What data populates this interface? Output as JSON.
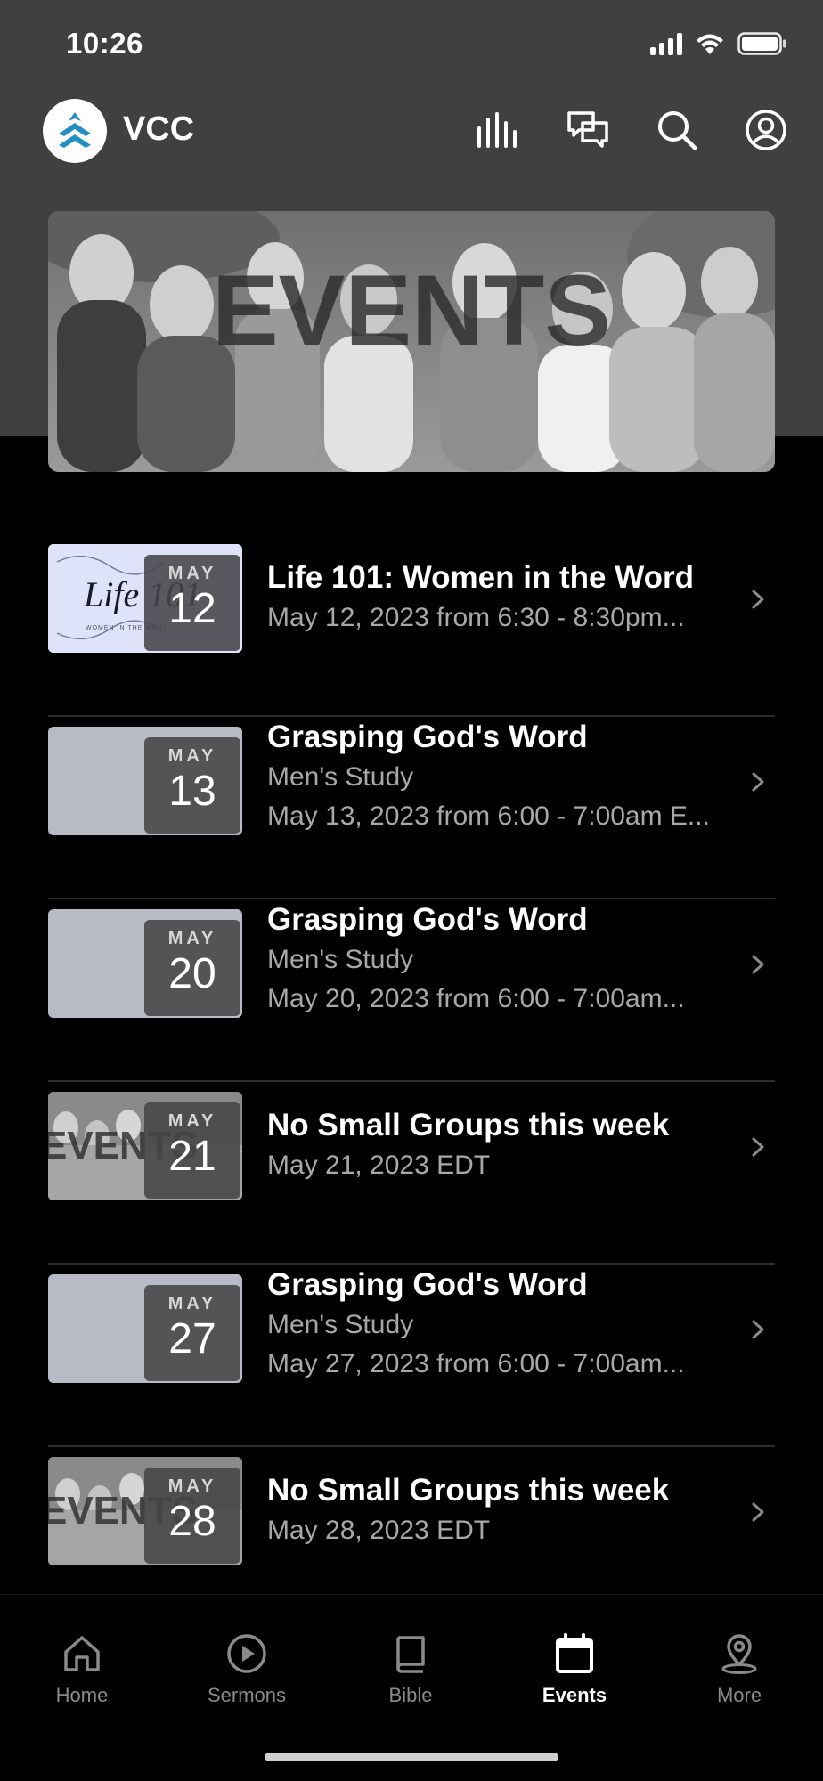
{
  "status_bar": {
    "time": "10:26",
    "icons": [
      "cellular-signal-icon",
      "wifi-icon",
      "battery-icon"
    ]
  },
  "header": {
    "app_title": "VCC",
    "icons": [
      "audio-bars-icon",
      "chat-icon",
      "search-icon",
      "profile-icon"
    ]
  },
  "banner": {
    "text": "EVENTS"
  },
  "events": [
    {
      "title": "Life 101: Women in the Word",
      "subtitle": "",
      "datetime": "May 12, 2023 from 6:30 - 8:30pm...",
      "month": "MAY",
      "day": "12",
      "thumb_logo": "Life 101",
      "thumb_caption": "WOMEN IN THE WORD"
    },
    {
      "title": "Grasping God's Word",
      "subtitle": "Men's Study",
      "datetime": "May 13, 2023 from 6:00 - 7:00am E...",
      "month": "MAY",
      "day": "13"
    },
    {
      "title": "Grasping God's Word",
      "subtitle": "Men's Study",
      "datetime": "May 20, 2023 from 6:00 - 7:00am...",
      "month": "MAY",
      "day": "20"
    },
    {
      "title": "No Small Groups this week",
      "subtitle": "",
      "datetime": "May 21, 2023 EDT",
      "month": "MAY",
      "day": "21",
      "thumb_text": "EVENTS"
    },
    {
      "title": "Grasping God's Word",
      "subtitle": "Men's Study",
      "datetime": "May 27, 2023 from 6:00 - 7:00am...",
      "month": "MAY",
      "day": "27"
    },
    {
      "title": "No Small Groups this week",
      "subtitle": "",
      "datetime": "May 28, 2023 EDT",
      "month": "MAY",
      "day": "28",
      "thumb_text": "EVENTS"
    }
  ],
  "tab_bar": {
    "tabs": [
      {
        "label": "Home",
        "icon": "home-icon"
      },
      {
        "label": "Sermons",
        "icon": "play-circle-icon"
      },
      {
        "label": "Bible",
        "icon": "book-icon"
      },
      {
        "label": "Events",
        "icon": "calendar-icon",
        "active": true
      },
      {
        "label": "More",
        "icon": "map-pin-icon"
      }
    ]
  },
  "colors": {
    "background": "#000000",
    "header_bg": "#404040",
    "accent_logo": "#1f8fc4",
    "text_primary": "#ffffff",
    "text_secondary": "#a8a8a8",
    "tab_inactive": "#8a8a8a",
    "divider": "#2c2c2c"
  }
}
